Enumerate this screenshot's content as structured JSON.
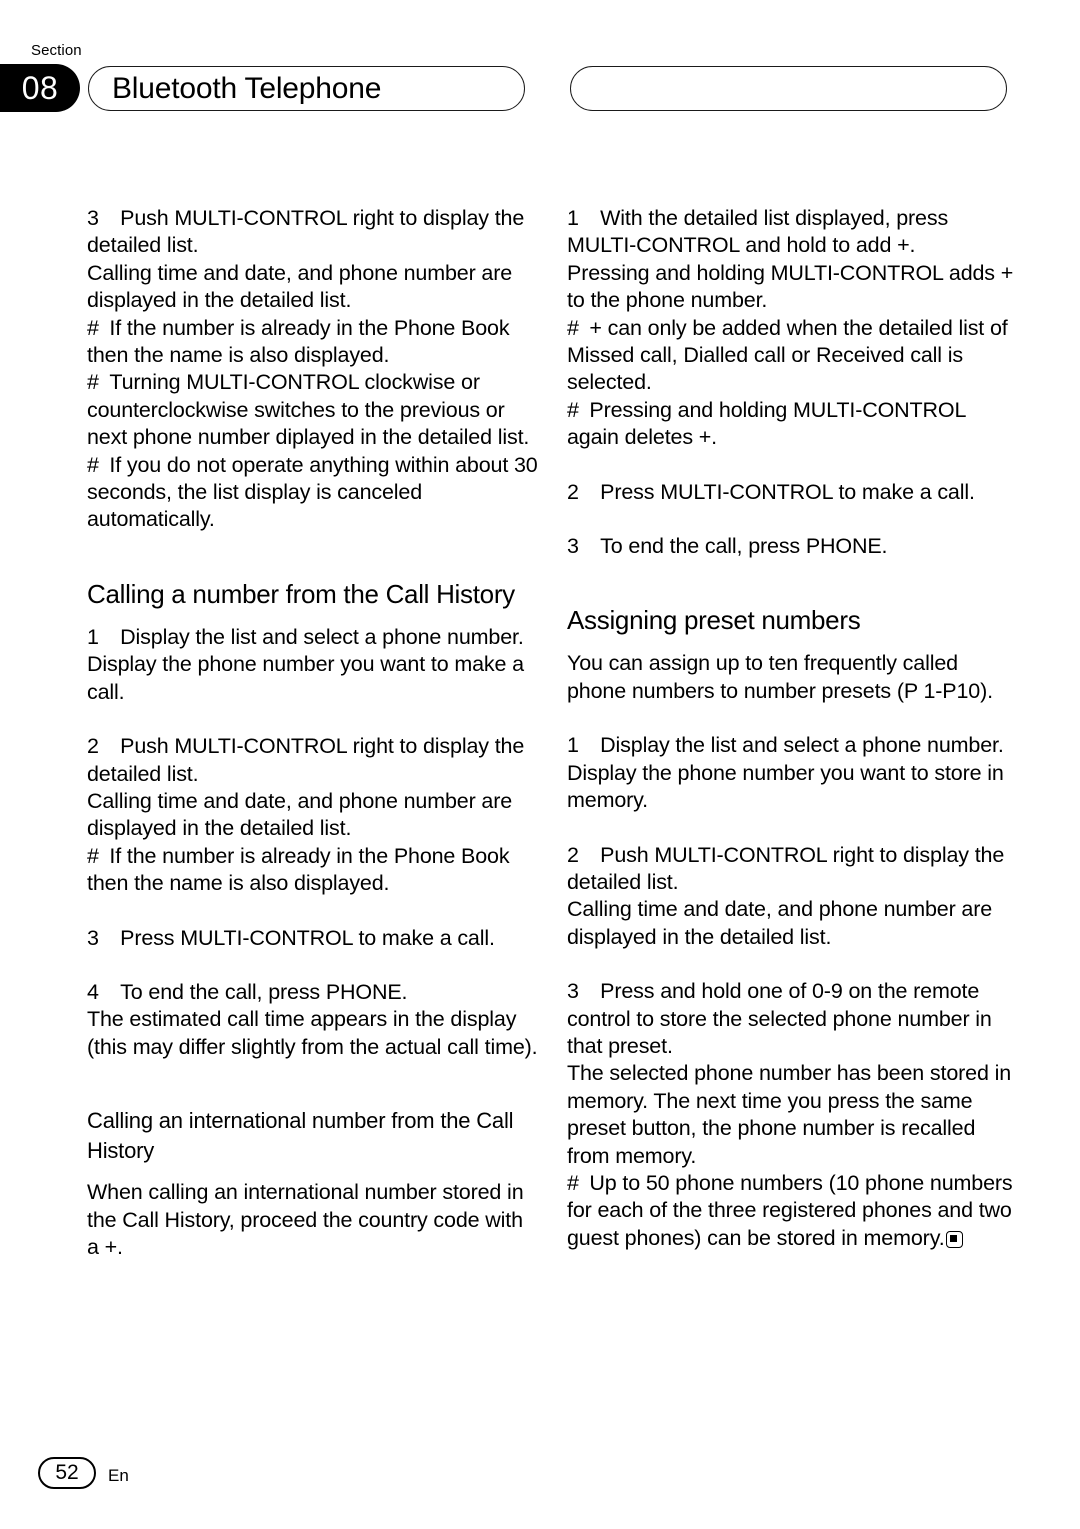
{
  "header": {
    "section_word": "Section",
    "section_number": "08",
    "title": "Bluetooth Telephone"
  },
  "left_column": {
    "step3_title": "3 Push MULTI-CONTROL right to display the detailed list.",
    "step3_note": "Calling time and date, and phone number are displayed in the detailed list.",
    "step3_bullet1": "# If the number is already in the Phone Book then the name is also displayed.",
    "step3_bullet2": "# Turning MULTI-CONTROL clockwise or counterclockwise switches to the previous or next phone number diplayed in the detailed list.",
    "step3_bullet3": "# If you do not operate anything within about 30 seconds, the list display is canceled automatically.",
    "heading_call_history": "Calling a number from the Call History",
    "ch_step1_title": "1 Display the list and select a phone number.",
    "ch_step1_note": "Display the phone number you want to make a call.",
    "ch_step2_title": "2 Push MULTI-CONTROL right to display the detailed list.",
    "ch_step2_note": "Calling time and date, and phone number are displayed in the detailed list.",
    "ch_step2_bullet": "# If the number is already in the Phone Book then the name is also displayed.",
    "ch_step3_title": "3 Press MULTI-CONTROL to make a call.",
    "ch_step4_title": "4 To end the call, press PHONE.",
    "ch_step4_note": "The estimated call time appears in the display (this may differ slightly from the actual call time).",
    "subheading_international": "Calling an international number from the Call History",
    "international_note": "When calling an international number stored in the Call History, proceed the country code with a +."
  },
  "right_column": {
    "intl_step1_title": "1 With the detailed list displayed, press MULTI-CONTROL and hold to add +.",
    "intl_step1_note": "Pressing and holding MULTI-CONTROL adds + to the phone number.",
    "intl_step1_bullet1": "# + can only be added when the detailed list of Missed call, Dialled call or Received call is selected.",
    "intl_step1_bullet2": "# Pressing and holding MULTI-CONTROL again deletes +.",
    "intl_step2_title": "2 Press MULTI-CONTROL to make a call.",
    "intl_step3_title": "3 To end the call, press PHONE.",
    "heading_presets": "Assigning preset numbers",
    "presets_intro": "You can assign up to ten frequently called phone numbers to number presets (P 1-P10).",
    "p_step1_title": "1 Display the list and select a phone number.",
    "p_step1_note": "Display the phone number you want to store in memory.",
    "p_step2_title": "2 Push MULTI-CONTROL right to display the detailed list.",
    "p_step2_note": "Calling time and date, and phone number are displayed in the detailed list.",
    "p_step3_title": "3 Press and hold one of 0-9 on the remote control to store the selected phone number in that preset.",
    "p_step3_note": "The selected phone number has been stored in memory. The next time you press the same preset button, the phone number is recalled from memory.",
    "p_step3_bullet": "# Up to 50 phone numbers (10 phone numbers for each of the three registered phones and two guest phones) can be stored in memory."
  },
  "footer": {
    "page_number": "52",
    "language": "En"
  }
}
